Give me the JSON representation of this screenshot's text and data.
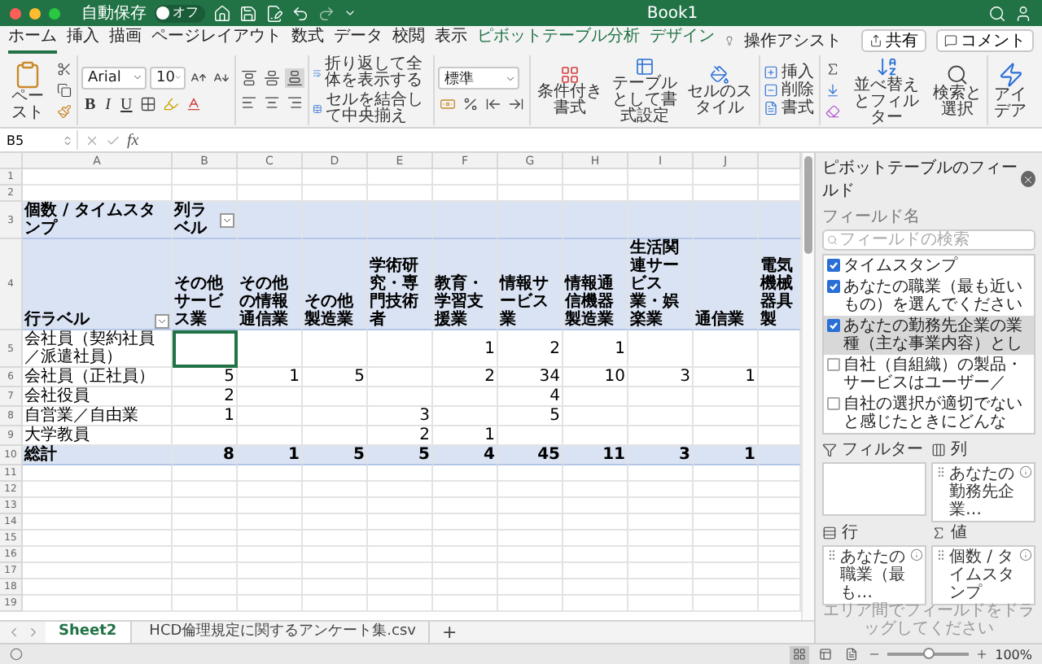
{
  "title_bar": {
    "autosave": {
      "label": "自動保存",
      "state_text": "オフ",
      "on": false
    },
    "title": "Book1"
  },
  "ribbon_tabs": [
    {
      "label": "ホーム",
      "selected": true,
      "contextual": false
    },
    {
      "label": "挿入",
      "selected": false,
      "contextual": false
    },
    {
      "label": "描画",
      "selected": false,
      "contextual": false
    },
    {
      "label": "ページレイアウト",
      "selected": false,
      "contextual": false
    },
    {
      "label": "数式",
      "selected": false,
      "contextual": false
    },
    {
      "label": "データ",
      "selected": false,
      "contextual": false
    },
    {
      "label": "校閲",
      "selected": false,
      "contextual": false
    },
    {
      "label": "表示",
      "selected": false,
      "contextual": false
    },
    {
      "label": "ピボットテーブル分析",
      "selected": false,
      "contextual": true
    },
    {
      "label": "デザイン",
      "selected": false,
      "contextual": true
    }
  ],
  "tell_me": "操作アシスト",
  "share_button": "共有",
  "comment_button": "コメント",
  "ribbon": {
    "paste": "ペースト",
    "font_name": "Arial",
    "font_size": "10",
    "bold": "B",
    "italic": "I",
    "underline": "U",
    "wrap_text": "折り返して全体を表示する",
    "merge_center": "セルを結合して中央揃え",
    "number_format": "標準",
    "styles": [
      {
        "kind": "conditional",
        "label": "条件付き書式"
      },
      {
        "kind": "table",
        "label": "テーブルとして書式設定"
      },
      {
        "kind": "cell",
        "label": "セルのスタイル"
      }
    ],
    "cells": [
      {
        "kind": "insert",
        "label": "挿入"
      },
      {
        "kind": "delete",
        "label": "削除"
      },
      {
        "kind": "format",
        "label": "書式"
      }
    ],
    "sort_filter": "並べ替えとフィルター",
    "find_select": "検索と選択",
    "ideas": "アイデア"
  },
  "formula_bar": {
    "name_box": "B5",
    "fx": "fx"
  },
  "sheet": {
    "columns": [
      "A",
      "B",
      "C",
      "D",
      "E",
      "F",
      "G",
      "H",
      "I",
      "J"
    ],
    "rows": [
      {
        "number": "1",
        "kind": "empty"
      },
      {
        "number": "2",
        "kind": "empty"
      },
      {
        "number": "3",
        "kind": "pivot_header",
        "cells": [
          {
            "text": "個数 / タイムスタンプ",
            "selected": false
          },
          {
            "text": "列ラベル",
            "filter": true,
            "selected": false
          },
          {
            "selected": false
          },
          {
            "selected": false
          },
          {
            "selected": false
          },
          {
            "selected": false
          },
          {
            "selected": false
          },
          {
            "selected": false
          },
          {
            "selected": false
          },
          {
            "selected": false
          },
          {
            "selected": false
          }
        ]
      },
      {
        "number": "4",
        "kind": "field_header",
        "cells": [
          {
            "text": "行ラベル",
            "filter": true,
            "selected": false
          },
          {
            "text": "その他サービス業",
            "selected": false
          },
          {
            "text": "その他の情報通信業",
            "selected": false
          },
          {
            "text": "その他製造業",
            "selected": false
          },
          {
            "text": "学術研究・専門技術者",
            "selected": false
          },
          {
            "text": "教育・学習支援業",
            "selected": false
          },
          {
            "text": "情報サービス業",
            "selected": false
          },
          {
            "text": "情報通信機器製造業",
            "selected": false
          },
          {
            "text": "生活関連サービス業・娯楽業",
            "selected": false
          },
          {
            "text": "通信業",
            "selected": false
          },
          {
            "text": "電気機械器具製",
            "selected": false
          }
        ]
      },
      {
        "number": "5",
        "kind": "data",
        "cells": [
          {
            "text": "会社員（契約社員／派遣社員）",
            "selected": false
          },
          {
            "selected": true
          },
          {
            "selected": false
          },
          {
            "selected": false
          },
          {
            "selected": false
          },
          {
            "text": "1",
            "selected": false
          },
          {
            "text": "2",
            "selected": false
          },
          {
            "text": "1",
            "selected": false
          },
          {
            "selected": false
          },
          {
            "selected": false
          },
          {
            "selected": false
          }
        ]
      },
      {
        "number": "6",
        "kind": "data",
        "cells": [
          {
            "text": "会社員（正社員）",
            "selected": false
          },
          {
            "text": "5",
            "selected": false
          },
          {
            "text": "1",
            "selected": false
          },
          {
            "text": "5",
            "selected": false
          },
          {
            "selected": false
          },
          {
            "text": "2",
            "selected": false
          },
          {
            "text": "34",
            "selected": false
          },
          {
            "text": "10",
            "selected": false
          },
          {
            "text": "3",
            "selected": false
          },
          {
            "text": "1",
            "selected": false
          },
          {
            "selected": false
          }
        ]
      },
      {
        "number": "7",
        "kind": "data",
        "cells": [
          {
            "text": "会社役員",
            "selected": false
          },
          {
            "text": "2",
            "selected": false
          },
          {
            "selected": false
          },
          {
            "selected": false
          },
          {
            "selected": false
          },
          {
            "selected": false
          },
          {
            "text": "4",
            "selected": false
          },
          {
            "selected": false
          },
          {
            "selected": false
          },
          {
            "selected": false
          },
          {
            "selected": false
          }
        ]
      },
      {
        "number": "8",
        "kind": "data",
        "cells": [
          {
            "text": "自営業／自由業",
            "selected": false
          },
          {
            "text": "1",
            "selected": false
          },
          {
            "selected": false
          },
          {
            "selected": false
          },
          {
            "text": "3",
            "selected": false
          },
          {
            "selected": false
          },
          {
            "text": "5",
            "selected": false
          },
          {
            "selected": false
          },
          {
            "selected": false
          },
          {
            "selected": false
          },
          {
            "selected": false
          }
        ]
      },
      {
        "number": "9",
        "kind": "data",
        "cells": [
          {
            "text": "大学教員",
            "selected": false
          },
          {
            "selected": false
          },
          {
            "selected": false
          },
          {
            "selected": false
          },
          {
            "text": "2",
            "selected": false
          },
          {
            "text": "1",
            "selected": false
          },
          {
            "selected": false
          },
          {
            "selected": false
          },
          {
            "selected": false
          },
          {
            "selected": false
          },
          {
            "selected": false
          }
        ]
      },
      {
        "number": "10",
        "kind": "total",
        "cells": [
          {
            "text": "総計",
            "selected": false
          },
          {
            "text": "8",
            "selected": false
          },
          {
            "text": "1",
            "selected": false
          },
          {
            "text": "5",
            "selected": false
          },
          {
            "text": "5",
            "selected": false
          },
          {
            "text": "4",
            "selected": false
          },
          {
            "text": "45",
            "selected": false
          },
          {
            "text": "11",
            "selected": false
          },
          {
            "text": "3",
            "selected": false
          },
          {
            "text": "1",
            "selected": false
          },
          {
            "selected": false
          }
        ]
      },
      {
        "number": "11",
        "kind": "empty"
      },
      {
        "number": "12",
        "kind": "empty"
      },
      {
        "number": "13",
        "kind": "empty"
      },
      {
        "number": "14",
        "kind": "empty"
      },
      {
        "number": "15",
        "kind": "empty"
      },
      {
        "number": "16",
        "kind": "empty"
      },
      {
        "number": "17",
        "kind": "empty"
      },
      {
        "number": "18",
        "kind": "empty"
      },
      {
        "number": "19",
        "kind": "empty"
      }
    ]
  },
  "sheet_tabs": [
    {
      "label": "Sheet2",
      "selected": true
    },
    {
      "label": "HCD倫理規定に関するアンケート集.csv",
      "selected": false
    }
  ],
  "add_sheet": "+",
  "pivot_panel": {
    "title": "ピボットテーブルのフィールド",
    "field_label": "フィールド名",
    "search_placeholder": "フィールドの検索",
    "fields": [
      {
        "label": "タイムスタンプ",
        "checked": true,
        "selected": false
      },
      {
        "label": "あなたの職業（最も近いもの）を選んでください",
        "checked": true,
        "selected": false
      },
      {
        "label": "あなたの勤務先企業の業種（主な事業内容）とし",
        "checked": true,
        "selected": true
      },
      {
        "label": "自社（自組織）の製品・サービスはユーザー／",
        "checked": false,
        "selected": false
      },
      {
        "label": "自社の選択が適切でないと感じたときにどんな",
        "checked": false,
        "selected": false
      }
    ],
    "areas": [
      {
        "kind": "filter",
        "label": "フィルター"
      },
      {
        "kind": "columns",
        "label": "列",
        "items": [
          "あなたの勤務先企業…"
        ]
      },
      {
        "kind": "rows",
        "label": "行",
        "items": [
          "あなたの職業（最も…"
        ]
      },
      {
        "kind": "values",
        "label": "値",
        "items": [
          "個数 / タイムスタンプ"
        ]
      }
    ],
    "hint": "エリア間でフィールドをドラッグしてください"
  },
  "status_bar": {
    "view_modes": [
      {
        "kind": "normal",
        "selected": true
      },
      {
        "kind": "page_layout",
        "selected": false
      },
      {
        "kind": "page_break",
        "selected": false
      }
    ],
    "zoom": {
      "level": 0.5,
      "text": "100%"
    }
  }
}
